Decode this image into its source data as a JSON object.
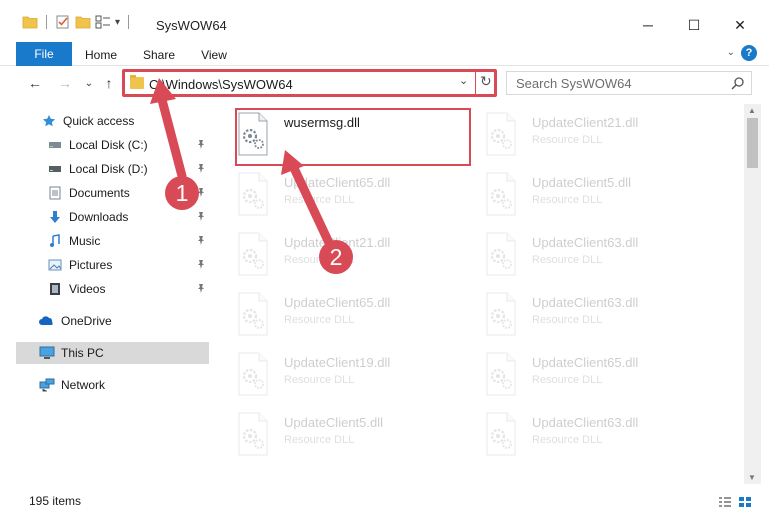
{
  "window": {
    "title": "SysWOW64",
    "minimize": "─",
    "maximize": "☐",
    "close": "✕"
  },
  "qat": {
    "overflow": "▾"
  },
  "ribbon": {
    "tabs": [
      {
        "label": "File"
      },
      {
        "label": "Home"
      },
      {
        "label": "Share"
      },
      {
        "label": "View"
      }
    ],
    "help": "?",
    "collapse": "⌄"
  },
  "nav": {
    "back": "←",
    "forward": "→",
    "recent": "⌄",
    "up": "↑"
  },
  "address": {
    "path": "C:\\Windows\\SysWOW64",
    "dropdown": "⌄",
    "refresh": "↻"
  },
  "search": {
    "placeholder": "Search SysWOW64"
  },
  "sidebar": {
    "items": [
      {
        "label": "Quick access",
        "icon": "star-icon"
      },
      {
        "label": "Local Disk (C:)",
        "icon": "drive-icon",
        "pinned": true
      },
      {
        "label": "Local Disk (D:)",
        "icon": "drive-icon",
        "pinned": true
      },
      {
        "label": "Documents",
        "icon": "documents-icon",
        "pinned": true
      },
      {
        "label": "Downloads",
        "icon": "downloads-icon",
        "pinned": true
      },
      {
        "label": "Music",
        "icon": "music-icon",
        "pinned": true
      },
      {
        "label": "Pictures",
        "icon": "pictures-icon",
        "pinned": true
      },
      {
        "label": "Videos",
        "icon": "videos-icon",
        "pinned": true
      },
      {
        "label": "OneDrive",
        "icon": "onedrive-icon"
      },
      {
        "label": "This PC",
        "icon": "this-pc-icon",
        "selected": true
      },
      {
        "label": "Network",
        "icon": "network-icon"
      }
    ]
  },
  "files": [
    {
      "name": "wusermsg.dll",
      "type": "",
      "highlighted": true
    },
    {
      "name": "UpdateClient21.dll",
      "type": "Resource DLL"
    },
    {
      "name": "UpdateClient65.dll",
      "type": "Resource DLL"
    },
    {
      "name": "UpdateClient5.dll",
      "type": "Resource DLL"
    },
    {
      "name": "UpdateClient21.dll",
      "type": "Resource DLL"
    },
    {
      "name": "UpdateClient63.dll",
      "type": "Resource DLL"
    },
    {
      "name": "UpdateClient65.dll",
      "type": "Resource DLL"
    },
    {
      "name": "UpdateClient63.dll",
      "type": "Resource DLL"
    },
    {
      "name": "UpdateClient19.dll",
      "type": "Resource DLL"
    },
    {
      "name": "UpdateClient65.dll",
      "type": "Resource DLL"
    },
    {
      "name": "UpdateClient5.dll",
      "type": "Resource DLL"
    },
    {
      "name": "UpdateClient63.dll",
      "type": "Resource DLL"
    }
  ],
  "status": {
    "items_count": "195 items"
  },
  "annotations": {
    "step1": "1",
    "step2": "2",
    "color": "#d84a55"
  },
  "colors": {
    "accent": "#1979ca",
    "highlight_border": "#d84a55",
    "folder": "#f0c44c",
    "selected_bg": "#d9d9d9"
  }
}
